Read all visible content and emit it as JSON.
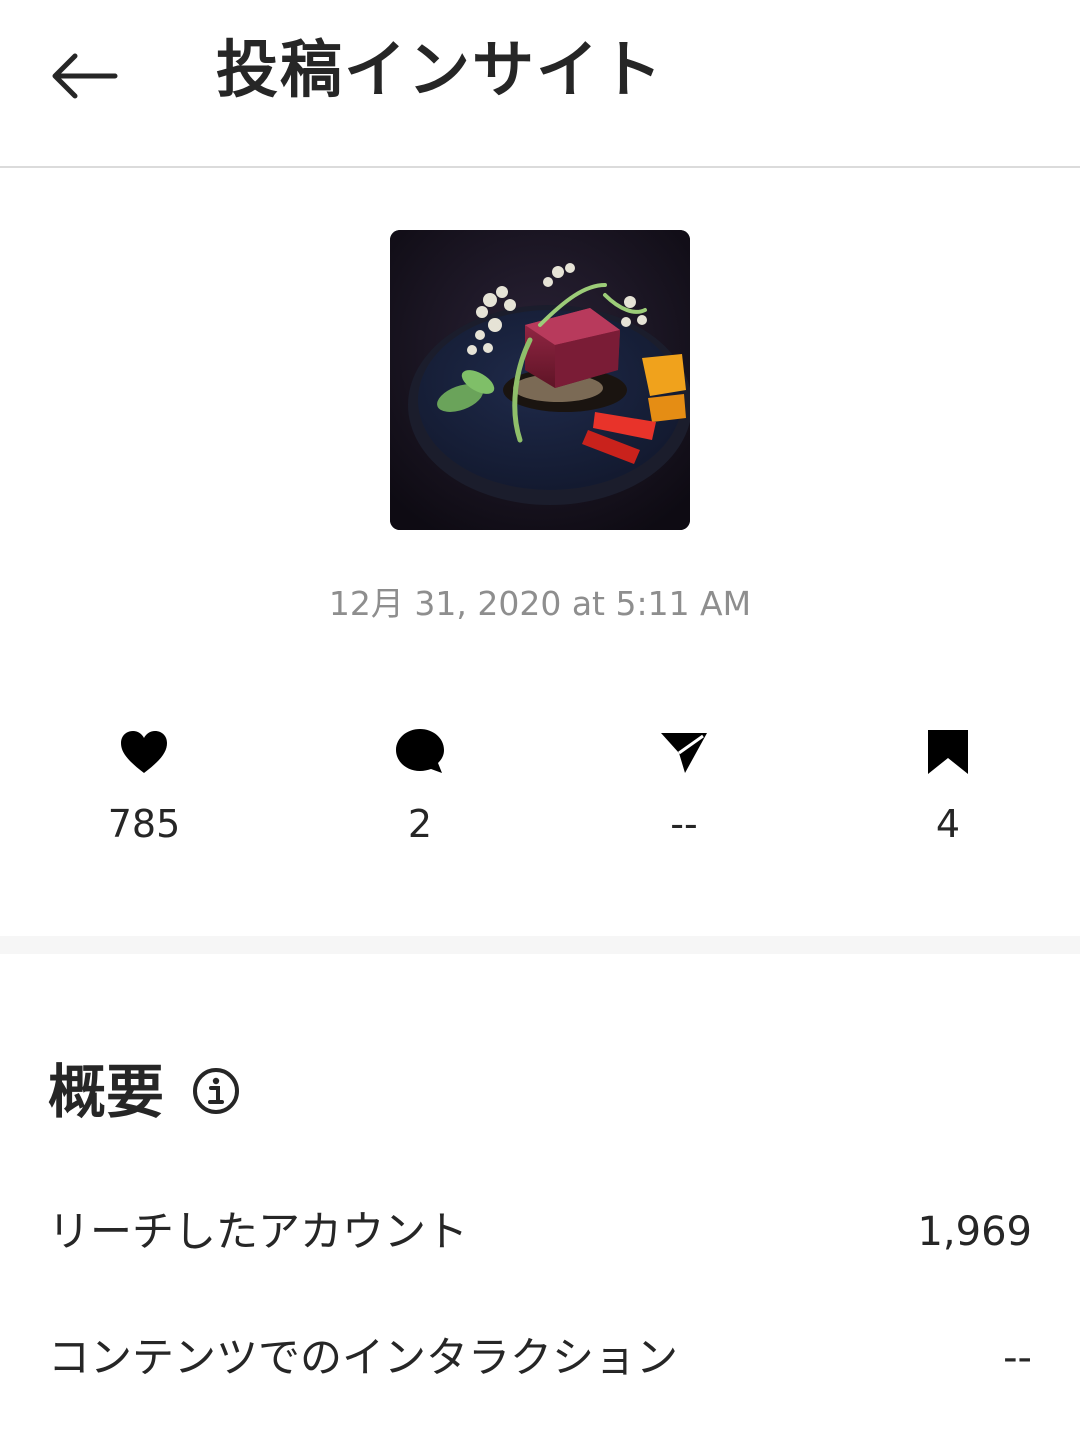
{
  "header": {
    "title": "投稿インサイト",
    "back_icon": "arrow-left-icon"
  },
  "post": {
    "date": "12月 31, 2020 at 5:11 AM"
  },
  "stats": {
    "likes": {
      "icon": "heart-icon",
      "value": "785"
    },
    "comments": {
      "icon": "comment-icon",
      "value": "2"
    },
    "shares": {
      "icon": "send-icon",
      "value": "--"
    },
    "saves": {
      "icon": "bookmark-icon",
      "value": "4"
    }
  },
  "overview": {
    "title": "概要",
    "info_icon": "info-icon",
    "rows": [
      {
        "label": "リーチしたアカウント",
        "value": "1,969"
      },
      {
        "label": "コンテンツでのインタラクション",
        "value": "--"
      }
    ]
  }
}
